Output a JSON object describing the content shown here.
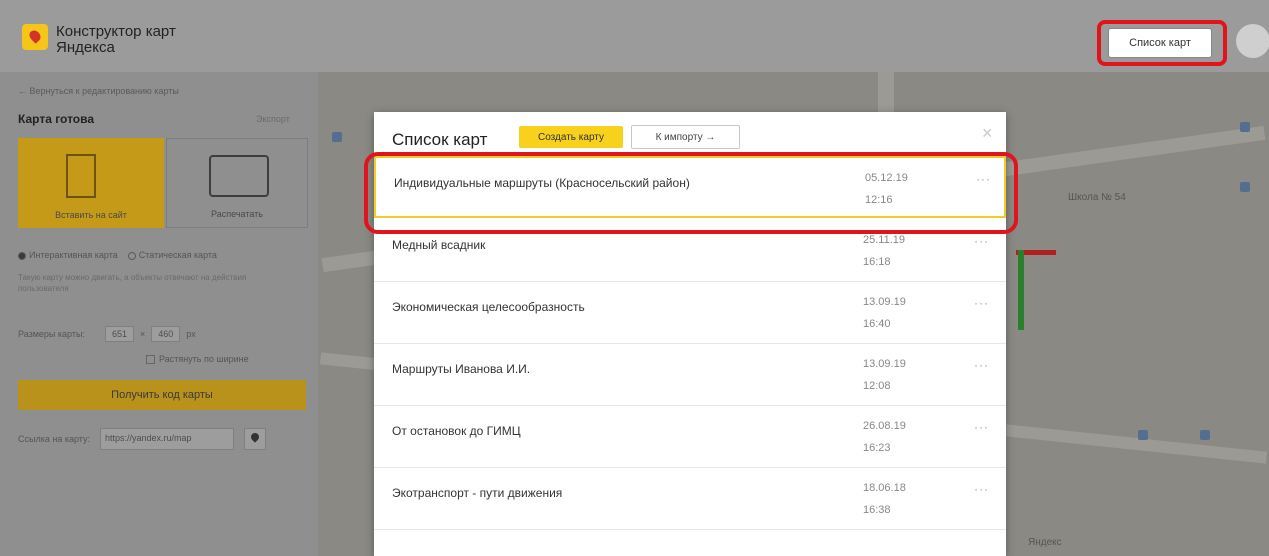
{
  "header": {
    "brand_line1": "Конструктор карт",
    "brand_line2": "Яндекса",
    "map_list_button": "Список карт"
  },
  "sidebar": {
    "back_link": "← Вернуться к редактированию карты",
    "title": "Карта готова",
    "export_link": "Экспорт",
    "embed_label": "Вставить на сайт",
    "print_label": "Распечатать",
    "interactive_label": "Интерактивная карта",
    "static_label": "Статическая карта",
    "note": "Такую карту можно двигать, а объекты отвечают на действия пользователя",
    "size_label": "Размеры карты:",
    "width_value": "651",
    "times": "×",
    "height_value": "460",
    "unit": "px",
    "stretch_label": "Растянуть по ширине",
    "get_code_button": "Получить код карты",
    "link_label": "Ссылка на карту:",
    "link_value": "https://yandex.ru/map"
  },
  "map": {
    "label_school": "Школа № 54",
    "label_yandex": "Яндекс"
  },
  "modal": {
    "title": "Список карт",
    "create_button": "Создать карту",
    "import_button": "К импорту →",
    "close": "×",
    "rows": [
      {
        "name": "Индивидуальные маршруты (Красносельский район)",
        "date": "05.12.19",
        "time": "12:16",
        "menu": "···"
      },
      {
        "name": "Медный всадник",
        "date": "25.11.19",
        "time": "16:18",
        "menu": "···"
      },
      {
        "name": "Экономическая целесообразность",
        "date": "13.09.19",
        "time": "16:40",
        "menu": "···"
      },
      {
        "name": "Маршруты Иванова И.И.",
        "date": "13.09.19",
        "time": "12:08",
        "menu": "···"
      },
      {
        "name": "От остановок до ГИМЦ",
        "date": "26.08.19",
        "time": "16:23",
        "menu": "···"
      },
      {
        "name": "Экотранспорт - пути движения",
        "date": "18.06.18",
        "time": "16:38",
        "menu": "···"
      }
    ]
  },
  "colors": {
    "accent_yellow": "#f7d11b",
    "highlight_red": "#e0141c",
    "selected_border": "#f2cd2a"
  }
}
